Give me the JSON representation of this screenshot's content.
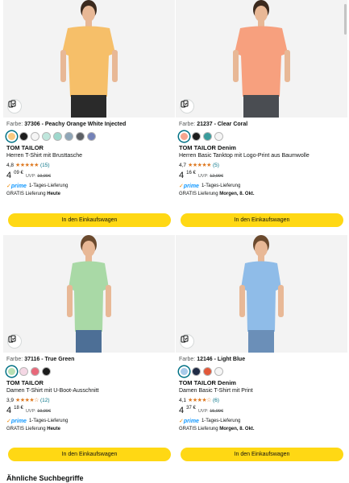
{
  "products": [
    {
      "color_label": "Farbe:",
      "color_value": "37306 - Peachy Orange White Injected",
      "swatches": [
        "#f8c97f",
        "#1c1c1c",
        "#f5f5f5",
        "#bfe6dc",
        "#9ed8cd",
        "#8fa6b8",
        "#5c5f64",
        "#7482b8"
      ],
      "selected_swatch": 0,
      "brand": "TOM TAILOR",
      "title": "Herren T-Shirt mit Brusttasche",
      "rating_value": "4,8",
      "stars": "★★★★★",
      "review_count": "(15)",
      "price_int": "4",
      "price_sup": "09 €",
      "uvp_label": "UVP:",
      "uvp_value": "19,99€",
      "prime_logo": "prime",
      "prime_text": "1-Tages-Lieferung",
      "ship_prefix": "GRATIS Lieferung",
      "ship_date": "Heute",
      "cart_label": "In den Einkaufswagen",
      "shirt_color": "#f6bf69",
      "pants_color": "#2a2a2a"
    },
    {
      "color_label": "Farbe:",
      "color_value": "21237 - Clear Coral",
      "swatches": [
        "#f7a58e",
        "#1c1c1c",
        "#3a9c9c",
        "#f5f5f5"
      ],
      "selected_swatch": 0,
      "brand": "TOM TAILOR Denim",
      "title": "Herren Basic Tanktop mit Logo-Print aus Baumwolle",
      "rating_value": "4,7",
      "stars": "★★★★★",
      "review_count": "(5)",
      "price_int": "4",
      "price_sup": "16 €",
      "uvp_label": "UVP:",
      "uvp_value": "12,99€",
      "prime_logo": "prime",
      "prime_text": "1-Tages-Lieferung",
      "ship_prefix": "GRATIS Lieferung",
      "ship_date": "Morgen, 8. Okt.",
      "cart_label": "In den Einkaufswagen",
      "shirt_color": "#f7a07e",
      "pants_color": "#4a4d52"
    },
    {
      "color_label": "Farbe:",
      "color_value": "37116 - True Green",
      "swatches": [
        "#b8e0b4",
        "#f4d7e4",
        "#e8687a",
        "#1c1c1c"
      ],
      "selected_swatch": 0,
      "brand": "TOM TAILOR",
      "title": "Damen T-Shirt mit U-Boot-Ausschnitt",
      "rating_value": "3,9",
      "stars": "★★★★☆",
      "review_count": "(12)",
      "price_int": "4",
      "price_sup": "18 €",
      "uvp_label": "UVP:",
      "uvp_value": "19,99€",
      "prime_logo": "prime",
      "prime_text": "1-Tages-Lieferung",
      "ship_prefix": "GRATIS Lieferung",
      "ship_date": "Heute",
      "cart_label": "In den Einkaufswagen",
      "shirt_color": "#a9d9a6",
      "pants_color": "#4d6f96"
    },
    {
      "color_label": "Farbe:",
      "color_value": "12146 - Light Blue",
      "swatches": [
        "#a9cbea",
        "#1f2b45",
        "#e2583a",
        "#f5f5f5"
      ],
      "selected_swatch": 0,
      "brand": "TOM TAILOR Denim",
      "title": "Damen Basic T-Shirt mit Print",
      "rating_value": "4,1",
      "stars": "★★★★☆",
      "review_count": "(6)",
      "price_int": "4",
      "price_sup": "37 €",
      "uvp_label": "UVP:",
      "uvp_value": "15,99€",
      "prime_logo": "prime",
      "prime_text": "1-Tages-Lieferung",
      "ship_prefix": "GRATIS Lieferung",
      "ship_date": "Morgen, 8. Okt.",
      "cart_label": "In den Einkaufswagen",
      "shirt_color": "#8fbce8",
      "pants_color": "#6b8fb8"
    }
  ],
  "related_heading": "Ähnliche Suchbegriffe",
  "colors": {
    "button_yellow": "#ffd814",
    "star_orange": "#de7921",
    "link_teal": "#007185",
    "prime_blue": "#1399ff"
  }
}
